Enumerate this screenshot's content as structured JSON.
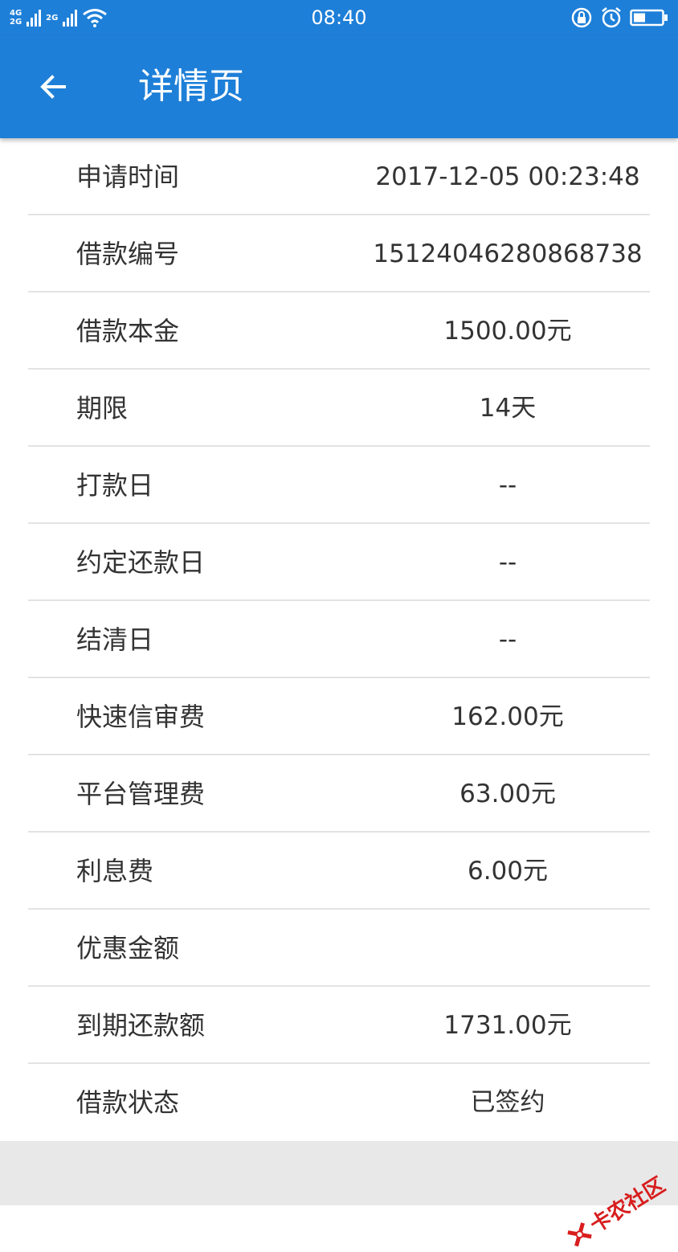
{
  "status_bar": {
    "network_top": "4G",
    "network_bottom": "2G",
    "network2": "2G",
    "time": "08:40",
    "icons": [
      "signal-icon",
      "wifi-icon",
      "rotation-lock-icon",
      "alarm-icon",
      "battery-icon"
    ]
  },
  "header": {
    "title": "详情页",
    "back_icon": "back-arrow-icon",
    "color": "#1e7fd8"
  },
  "details": [
    {
      "label": "申请时间",
      "value": "2017-12-05 00:23:48"
    },
    {
      "label": "借款编号",
      "value": "15124046280868738"
    },
    {
      "label": "借款本金",
      "value": "1500.00元"
    },
    {
      "label": "期限",
      "value": "14天"
    },
    {
      "label": "打款日",
      "value": "--"
    },
    {
      "label": "约定还款日",
      "value": "--"
    },
    {
      "label": "结清日",
      "value": "--"
    },
    {
      "label": "快速信审费",
      "value": "162.00元"
    },
    {
      "label": "平台管理费",
      "value": "63.00元"
    },
    {
      "label": "利息费",
      "value": "6.00元"
    },
    {
      "label": "优惠金额",
      "value": ""
    },
    {
      "label": "到期还款额",
      "value": "1731.00元"
    },
    {
      "label": "借款状态",
      "value": "已签约"
    }
  ],
  "watermark": {
    "text": "卡农社区",
    "color": "#d81e1e"
  }
}
